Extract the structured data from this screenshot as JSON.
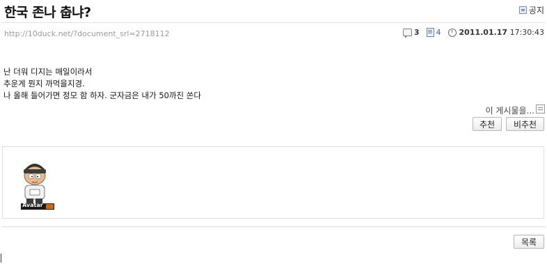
{
  "post": {
    "title": "한국 존나 춥냐?",
    "notice_label": "공지",
    "url": "http://10duck.net/?document_srl=2718112",
    "comments": "3",
    "trackbacks": "4",
    "date": "2011.01.17",
    "time": "17:30:43",
    "body_lines": [
      "난 더워 디지는 매일이라서",
      "추운게 뭔지 까먹을지경.",
      "나 올해 들어가면 정모 함 하자. 군자금은 내가 50까진 쏜다"
    ],
    "trackback_label": "이 게시물을...",
    "recommend_label": "추천",
    "not_recommend_label": "비추천",
    "avatar_caption": "Avatar",
    "list_label": "목록"
  },
  "colors": {
    "accent_blue": "#3a5fa8",
    "url_gray": "#9a9a9a"
  },
  "icons": [
    "notice-icon",
    "comment-icon",
    "document-icon",
    "clock-icon",
    "trackback-menu-icon"
  ]
}
